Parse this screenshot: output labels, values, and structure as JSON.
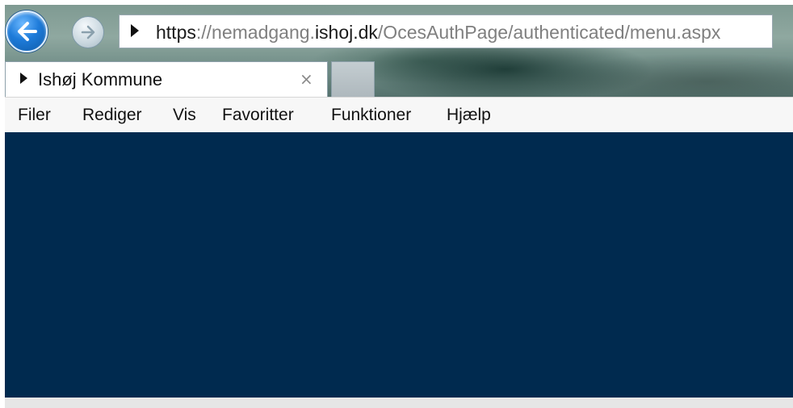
{
  "browser": {
    "address": {
      "scheme": "https",
      "sep": "://",
      "host_prefix": "nemadgang.",
      "host_domain": "ishoj.dk",
      "path": "/OcesAuthPage/authenticated/menu.aspx"
    },
    "tab": {
      "title": "Ishøj Kommune",
      "close_glyph": "×"
    },
    "menu": [
      "Filer",
      "Rediger",
      "Vis",
      "Favoritter",
      "Funktioner",
      "Hjælp"
    ]
  },
  "colors": {
    "content_bg": "#002a4f",
    "back_button": "#1e7bd9"
  },
  "icons": [
    "back-arrow-icon",
    "forward-arrow-icon",
    "play-icon",
    "close-icon"
  ]
}
